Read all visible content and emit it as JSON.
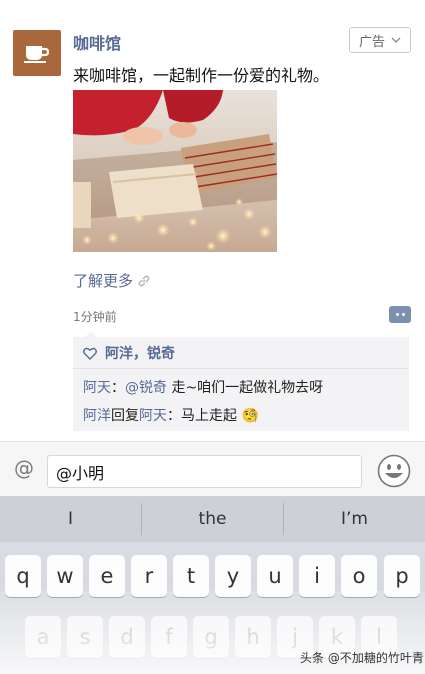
{
  "post": {
    "author": "咖啡馆",
    "ad_label": "广告",
    "text": "来咖啡馆，一起制作一份爱的礼物。",
    "learn_more": "了解更多",
    "timestamp": "1分钟前",
    "likes": "阿洋，锐奇",
    "comments": [
      {
        "name": "阿天",
        "colon": "：",
        "mention": "@锐奇",
        "text": " 走~咱们一起做礼物去呀"
      },
      {
        "name": "阿洋",
        "reply": "回复",
        "target": "阿天",
        "colon": "：",
        "text": "马上走起 🧐"
      }
    ]
  },
  "input": {
    "at_symbol": "@",
    "value": "@小明"
  },
  "keyboard": {
    "suggestions": [
      "I",
      "the",
      "I’m"
    ],
    "row1": [
      "q",
      "w",
      "e",
      "r",
      "t",
      "y",
      "u",
      "i",
      "o",
      "p"
    ],
    "row2": [
      "a",
      "s",
      "d",
      "f",
      "g",
      "h",
      "j",
      "k",
      "l"
    ]
  },
  "watermark": "头条 @不加糖的竹叶青",
  "colors": {
    "link_blue": "#576b95",
    "avatar_brown": "#a9673b",
    "box_gray": "#f3f3f5"
  }
}
